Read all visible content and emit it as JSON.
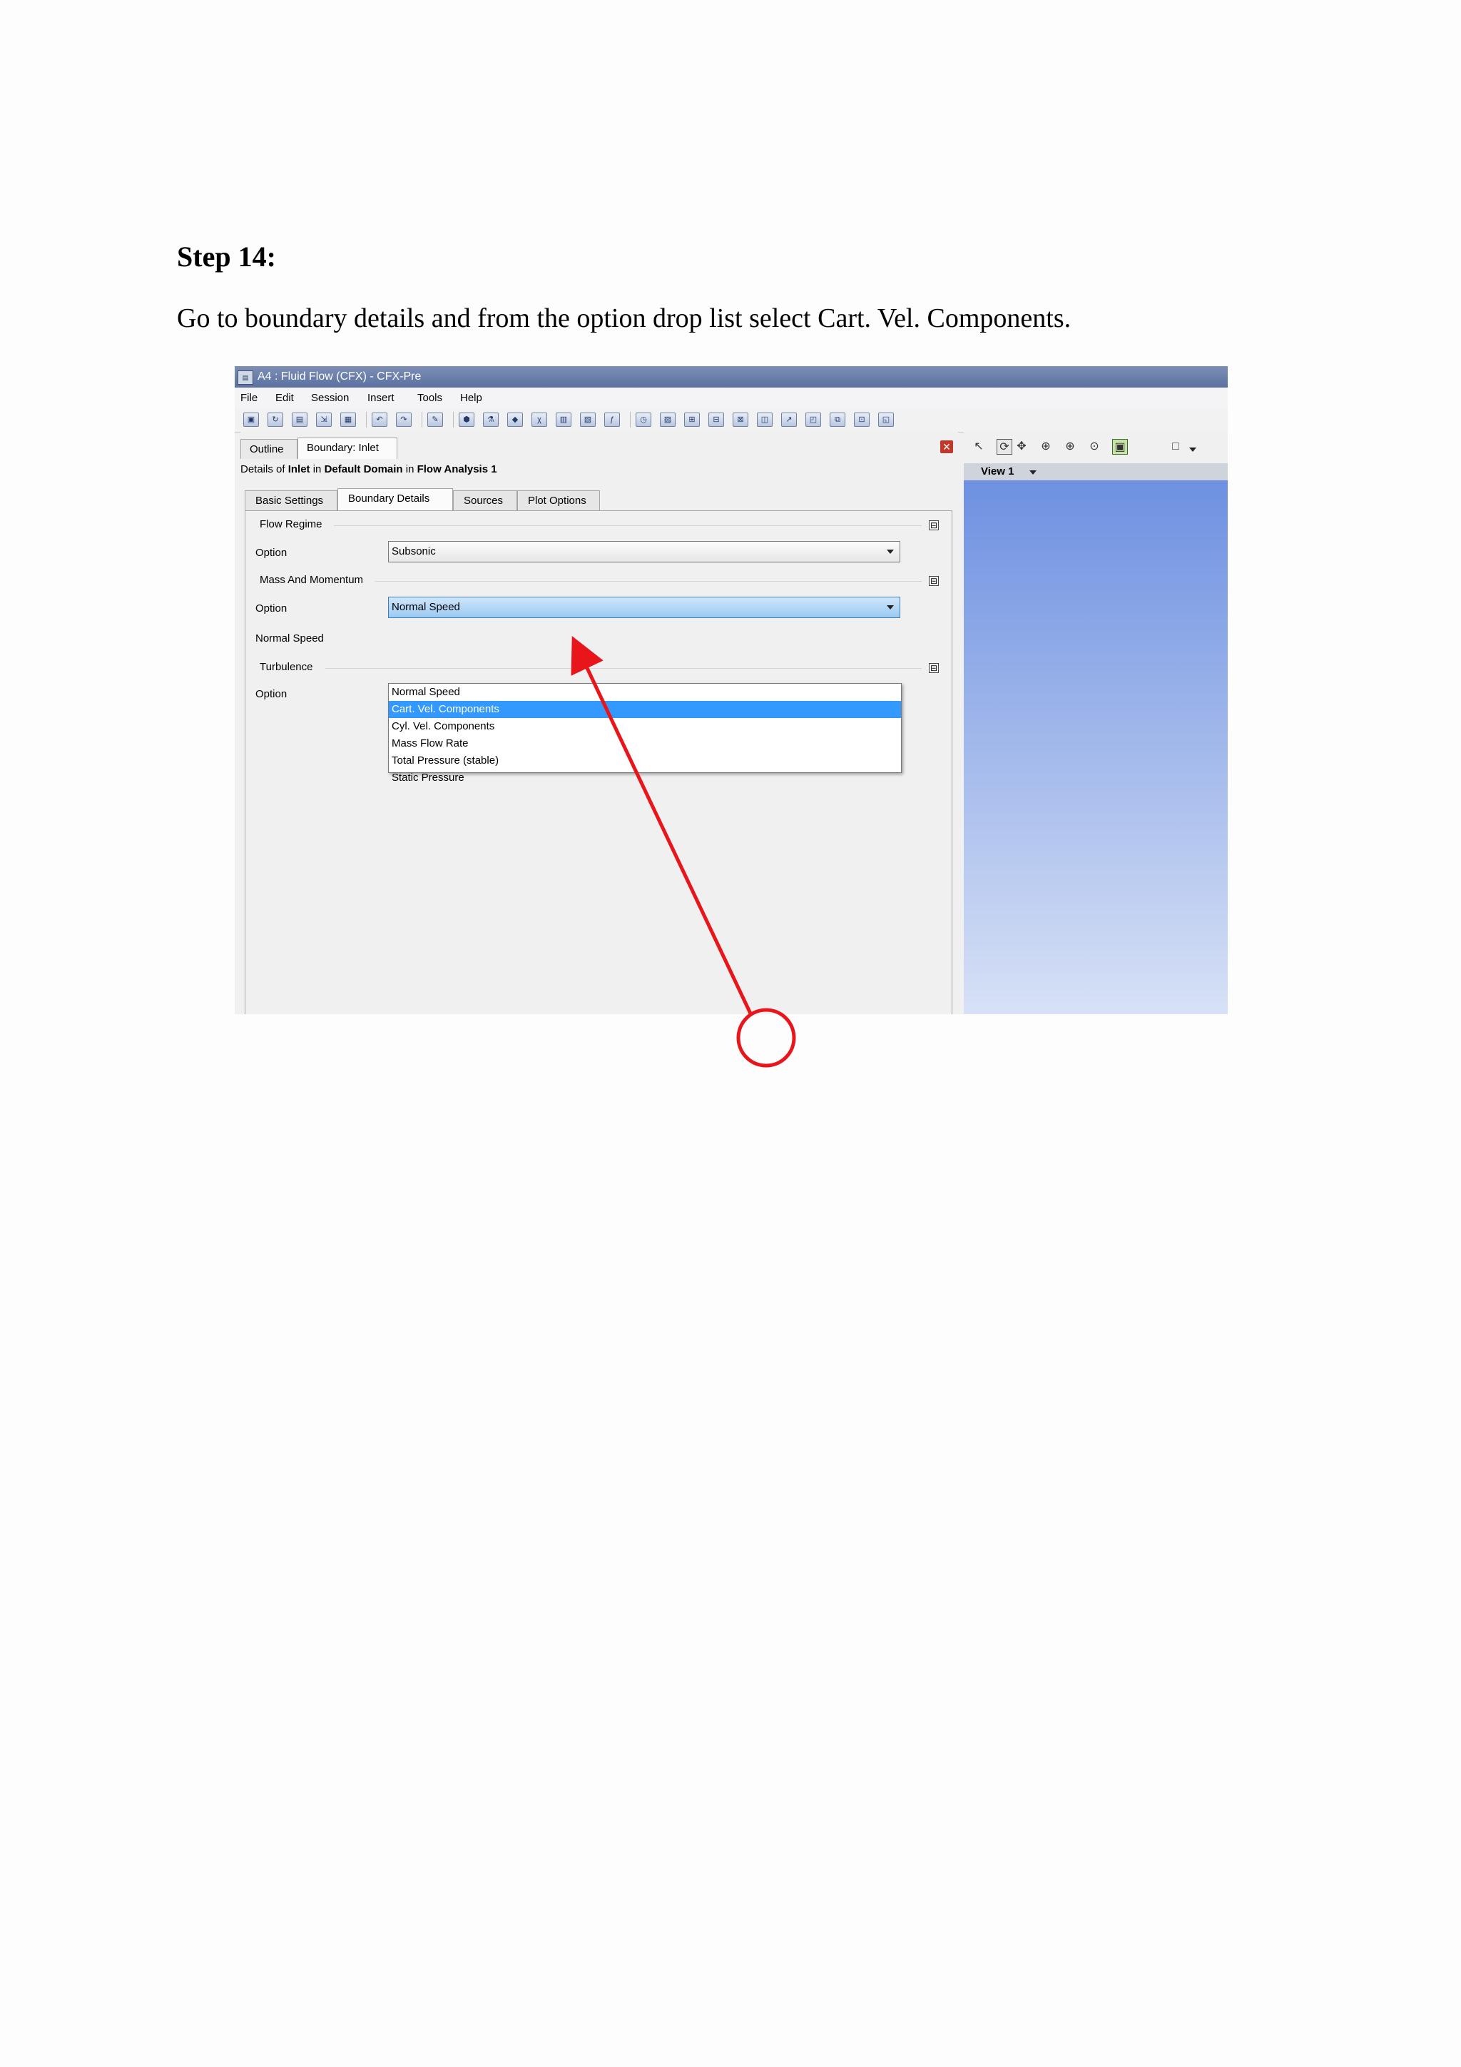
{
  "doc": {
    "step_title": "Step 14:",
    "instruction": "Go to boundary details and from the option drop list select Cart. Vel. Components."
  },
  "window": {
    "title": "A4 : Fluid Flow (CFX) - CFX-Pre",
    "app_icon": "cfx-app-icon"
  },
  "menu": [
    "File",
    "Edit",
    "Session",
    "Insert",
    "Tools",
    "Help"
  ],
  "toolbar_icons": [
    "save-icon",
    "refresh-icon",
    "open-icon",
    "import-icon",
    "report-icon",
    "undo-icon",
    "redo-icon",
    "edit-icon",
    "domain-icon",
    "material-icon",
    "reaction-icon",
    "expression-icon",
    "variable-icon",
    "function-icon",
    "fx-icon",
    "time-icon",
    "mesh-icon",
    "boundary-icon",
    "interface-icon",
    "subdomain-icon",
    "source-icon",
    "velocity-icon",
    "monitor-icon",
    "transform-icon",
    "solver-icon",
    "output-icon"
  ],
  "top_tabs": [
    "Outline",
    "Boundary: Inlet"
  ],
  "details": {
    "prefix": "Details of ",
    "object": "Inlet",
    "in1": " in ",
    "domain": "Default Domain",
    "in2": " in ",
    "analysis": "Flow Analysis 1"
  },
  "inner_tabs": [
    "Basic Settings",
    "Boundary Details",
    "Sources",
    "Plot Options"
  ],
  "form": {
    "flow_regime": {
      "group": "Flow Regime",
      "option_label": "Option",
      "option_value": "Subsonic"
    },
    "mass_momentum": {
      "group": "Mass And Momentum",
      "option_label": "Option",
      "option_value": "Normal Speed",
      "normal_speed_label": "Normal Speed"
    },
    "turbulence": {
      "group": "Turbulence",
      "option_label": "Option"
    },
    "collapse_glyph": "⊟"
  },
  "dropdown": {
    "options": [
      "Normal Speed",
      "Cart. Vel. Components",
      "Cyl. Vel. Components",
      "Mass Flow Rate",
      "Total Pressure (stable)",
      "Static Pressure"
    ],
    "selected": "Cart. Vel. Components"
  },
  "viewer": {
    "label": "View 1",
    "icons": [
      "select-icon",
      "rotate-icon",
      "pan-icon",
      "zoom-icon",
      "zoom-box-icon",
      "zoom-fit-icon",
      "highlight-icon",
      "viewport-icon"
    ]
  },
  "annotation": {
    "arrow_color": "#e8161b",
    "circle_color": "#e8161b"
  }
}
